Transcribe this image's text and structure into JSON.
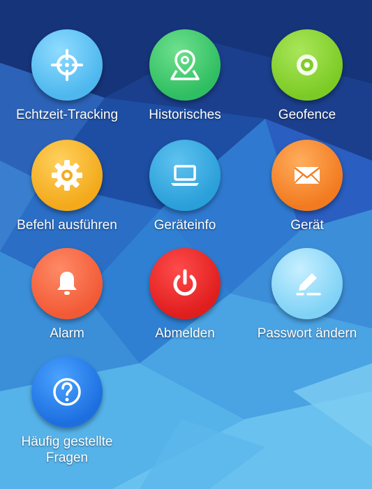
{
  "menu": {
    "items": [
      {
        "id": "echtzeit-tracking",
        "label": "Echtzeit-Tracking",
        "icon": "crosshair-icon",
        "color": "#55bdf0"
      },
      {
        "id": "historisches",
        "label": "Historisches",
        "icon": "map-pin-icon",
        "color": "#35c265"
      },
      {
        "id": "geofence",
        "label": "Geofence",
        "icon": "target-ring-icon",
        "color": "#80cc2a"
      },
      {
        "id": "befehl-ausfuehren",
        "label": "Befehl ausführen",
        "icon": "gear-icon",
        "color": "#f4ac1f"
      },
      {
        "id": "geraeteinfo",
        "label": "Geräteinfo",
        "icon": "laptop-icon",
        "color": "#2fa2da"
      },
      {
        "id": "geraet",
        "label": "Gerät",
        "icon": "envelope-icon",
        "color": "#f37f22"
      },
      {
        "id": "alarm",
        "label": "Alarm",
        "icon": "bell-icon",
        "color": "#f35f39"
      },
      {
        "id": "abmelden",
        "label": "Abmelden",
        "icon": "power-icon",
        "color": "#e22222"
      },
      {
        "id": "passwort-aendern",
        "label": "Passwort ändern",
        "icon": "pencil-icon",
        "color": "#86d4f6"
      },
      {
        "id": "haeufig-gestellte-fragen",
        "label": "Häufig gestellte Fragen",
        "icon": "question-icon",
        "color": "#2275e2"
      }
    ]
  }
}
